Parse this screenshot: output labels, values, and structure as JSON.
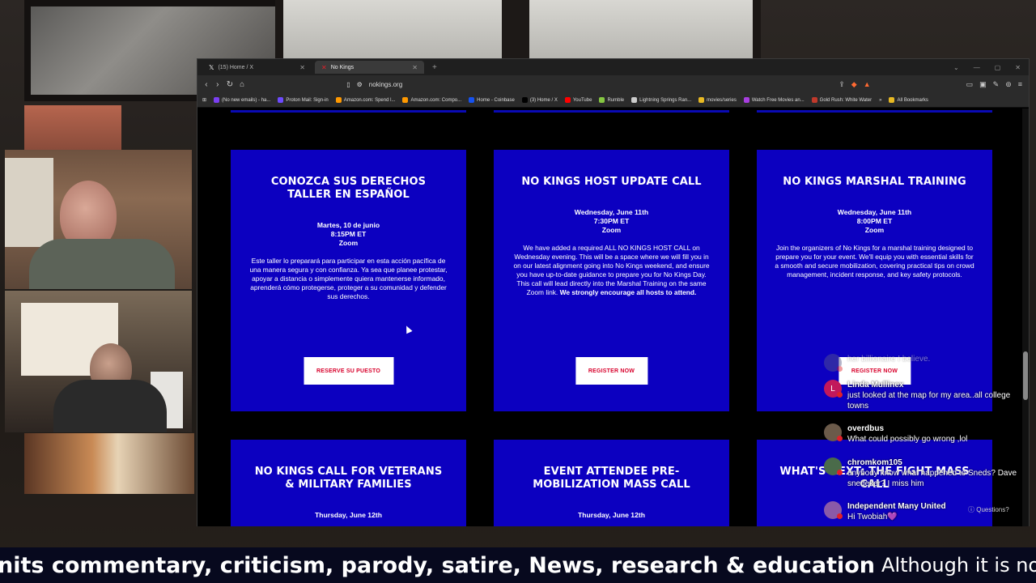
{
  "browser": {
    "tabs": [
      {
        "label": "(15) Home / X",
        "icon": "x-icon"
      },
      {
        "label": "No Kings",
        "icon": "no-kings-icon"
      }
    ],
    "url": "nokings.org",
    "bookmarks": [
      {
        "label": "(No new emails) - ha...",
        "color": "#7b3ff2"
      },
      {
        "label": "Proton Mail: Sign-in",
        "color": "#6d4aff"
      },
      {
        "label": "Amazon.com: Spend l...",
        "color": "#ff9900"
      },
      {
        "label": "Amazon.com: Compo...",
        "color": "#ff9900"
      },
      {
        "label": "Home - Coinbase",
        "color": "#1652f0"
      },
      {
        "label": "(3) Home / X",
        "color": "#000000"
      },
      {
        "label": "YouTube",
        "color": "#ff0000"
      },
      {
        "label": "Rumble",
        "color": "#85c742"
      },
      {
        "label": "Lightning Springs Ran...",
        "color": "#cccccc"
      },
      {
        "label": "movies/series",
        "color": "#e8b923"
      },
      {
        "label": "Watch Free Movies an...",
        "color": "#a83ee0"
      },
      {
        "label": "Gold Rush: White Water",
        "color": "#c0392b"
      }
    ],
    "all_bookmarks": "All Bookmarks"
  },
  "cards": [
    {
      "title": "CONOZCA SUS DERECHOS TALLER EN ESPAÑOL",
      "when": [
        "Martes, 10 de junio",
        "8:15PM ET",
        "Zoom"
      ],
      "desc": "Este taller lo preparará para participar en esta acción pacífica de una manera segura y con confianza. Ya sea que planee protestar, apoyar a distancia o simplemente quiera mantenerse informado, aprenderá cómo protegerse, proteger a su comunidad y defender sus derechos.",
      "desc_bold": "",
      "button": "RESERVE SU PUESTO"
    },
    {
      "title": "NO KINGS HOST UPDATE CALL",
      "when": [
        "Wednesday, June 11th",
        "7:30PM ET",
        "Zoom"
      ],
      "desc": "We have added a required ALL NO KINGS HOST CALL on Wednesday evening. This will be a space where we will fill you in on our latest alignment going into No Kings weekend, and ensure you have up-to-date guidance to prepare you for No Kings Day. This call will lead directly into the Marshal Training on the same Zoom link.",
      "desc_bold": "We strongly encourage all hosts to attend.",
      "button": "REGISTER NOW"
    },
    {
      "title": "NO KINGS MARSHAL TRAINING",
      "when": [
        "Wednesday, June 11th",
        "8:00PM ET",
        "Zoom"
      ],
      "desc": "Join the organizers of No Kings for a marshal training designed to prepare you for your event. We'll equip you with essential skills for a smooth and secure mobilization, covering practical tips on crowd management, incident response, and key safety protocols.",
      "desc_bold": "",
      "button": "REGISTER NOW"
    },
    {
      "title": "NO KINGS CALL FOR VETERANS & MILITARY FAMILIES",
      "when": [
        "Thursday, June 12th"
      ],
      "desc": "",
      "desc_bold": "",
      "button": ""
    },
    {
      "title": "EVENT ATTENDEE PRE-MOBILIZATION MASS CALL",
      "when": [
        "Thursday, June 12th"
      ],
      "desc": "",
      "desc_bold": "",
      "button": ""
    },
    {
      "title": "WHAT'S NEXT: THE FIGHT MASS CALL",
      "when": [],
      "desc": "",
      "desc_bold": "",
      "button": ""
    }
  ],
  "chat": {
    "messages": [
      {
        "user": "",
        "text": "her billionaire I believe.",
        "avatar_color": "#5a5a8a",
        "initial": "",
        "faded": true
      },
      {
        "user": "Linda Mullinex",
        "text": "just looked at the map for my area..all college towns",
        "avatar_color": "#c2185b",
        "initial": "L",
        "faded": false
      },
      {
        "user": "overdbus",
        "text": "What could possibly go wrong ,lol",
        "avatar_color": "#6b5a4a",
        "initial": "",
        "faded": false
      },
      {
        "user": "chromkom105",
        "text": "anybody know what happened to Sneds? Dave snedeker? I miss him",
        "avatar_color": "#4a6b4a",
        "initial": "",
        "faded": false
      },
      {
        "user": "Independent Many United",
        "text": "Hi Twobiah💜",
        "avatar_color": "#8a5aa8",
        "initial": "",
        "faded": false
      }
    ],
    "questions_label": "Questions?"
  },
  "ticker": {
    "bold": "nits commentary, criticism, parody, satire, News, research & education",
    "regular": "Although it is not"
  }
}
